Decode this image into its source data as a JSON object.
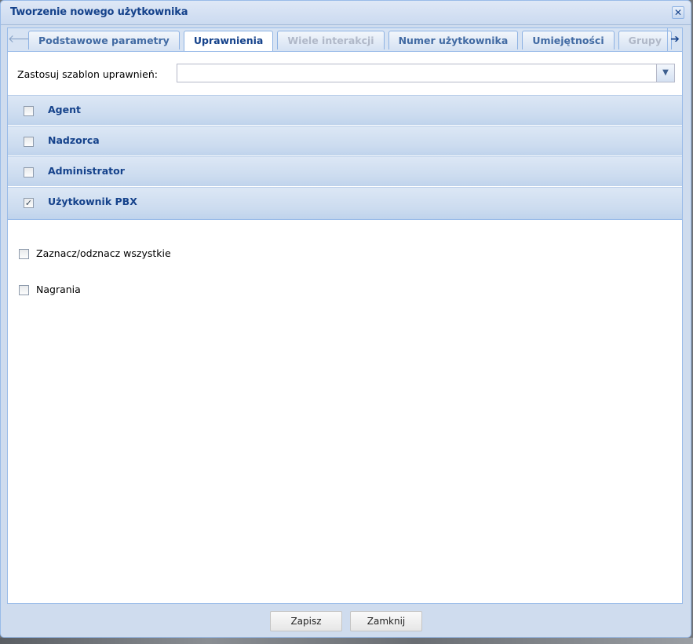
{
  "window": {
    "title": "Tworzenie nowego użytkownika",
    "close_icon": "close-icon"
  },
  "tabs": [
    {
      "label": "Podstawowe parametry",
      "state": "normal"
    },
    {
      "label": "Uprawnienia",
      "state": "active"
    },
    {
      "label": "Wiele interakcji",
      "state": "disabled"
    },
    {
      "label": "Numer użytkownika",
      "state": "normal"
    },
    {
      "label": "Umiejętności",
      "state": "normal"
    },
    {
      "label": "Grupy",
      "state": "disabled"
    }
  ],
  "tab_scroll": {
    "left_icon": "arrow-left-icon",
    "right_icon": "arrow-right-icon"
  },
  "template": {
    "label": "Zastosuj szablon uprawnień:",
    "value": "",
    "trigger_icon": "chevron-down-icon"
  },
  "groups": [
    {
      "label": "Agent",
      "checked": false
    },
    {
      "label": "Nadzorca",
      "checked": false
    },
    {
      "label": "Administrator",
      "checked": false
    },
    {
      "label": "Użytkownik PBX",
      "checked": true
    }
  ],
  "options": {
    "select_all": {
      "label": "Zaznacz/odznacz wszystkie",
      "checked": false
    },
    "recordings": {
      "label": "Nagrania",
      "checked": false
    }
  },
  "footer": {
    "save_label": "Zapisz",
    "close_label": "Zamknij"
  },
  "colors": {
    "accent": "#15428b",
    "header_bg": "#cbdaf0",
    "border": "#99bbe8"
  }
}
